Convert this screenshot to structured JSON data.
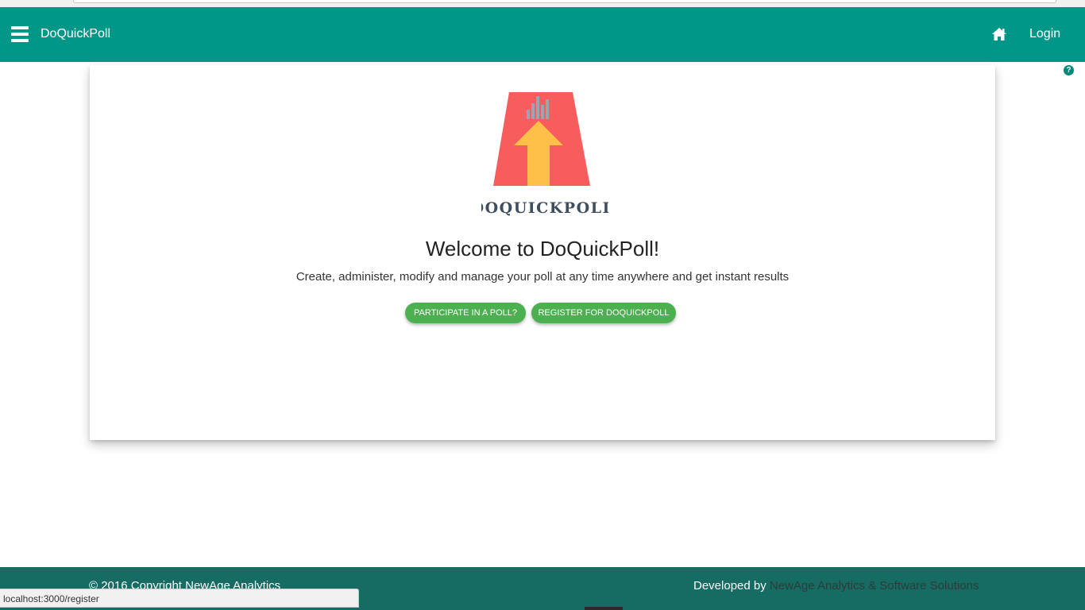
{
  "navbar": {
    "brand": "DoQuickPoll",
    "login_label": "Login",
    "background_color": "#009688",
    "menu_icon": "hamburger-menu-icon",
    "home_icon": "home-icon"
  },
  "help": {
    "icon": "question-circle-icon",
    "glyph": "?"
  },
  "card": {
    "logo_text": "DOQUICKPOLL",
    "welcome_title": "Welcome to DoQuickPoll!",
    "tagline": "Create, administer, modify and manage your poll at any time anywhere and get instant results",
    "participate_button": "PARTICIPATE IN A POLL?",
    "register_button": "REGISTER FOR DOQUICKPOLL",
    "button_color": "#4caf50"
  },
  "footer": {
    "copyright": "© 2016 Copyright NewAge Analytics",
    "developed_prefix": "Developed by ",
    "developed_link": "NewAge Analytics & Software Solutions",
    "background_color": "#166b63"
  },
  "status_bar": {
    "url": "localhost:3000/register"
  }
}
